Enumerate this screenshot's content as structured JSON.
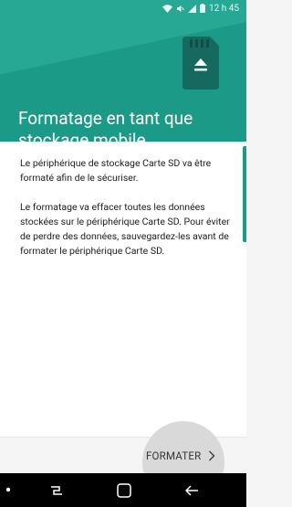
{
  "status_bar": {
    "time": "12 h 45"
  },
  "header": {
    "title": "Formatage en tant que stockage mobile"
  },
  "body": {
    "paragraph1": "Le périphérique de stockage Carte SD va être formaté afin de le sécuriser.",
    "paragraph2": "Le formatage va effacer toutes les données stockées sur le périphérique Carte SD. Pour éviter de perdre des données, sauvegardez-les avant de formater le périphérique Carte SD."
  },
  "footer": {
    "format_label": "FORMATER"
  },
  "colors": {
    "header": "#1b9a87",
    "header_light": "#27a894",
    "card_dark": "#15695e",
    "text": "#202020"
  },
  "icons": [
    "wifi-icon",
    "mute-icon",
    "signal-icon",
    "sd-card-eject-icon",
    "chevron-right-icon",
    "recent-apps-icon",
    "home-icon",
    "back-icon"
  ]
}
